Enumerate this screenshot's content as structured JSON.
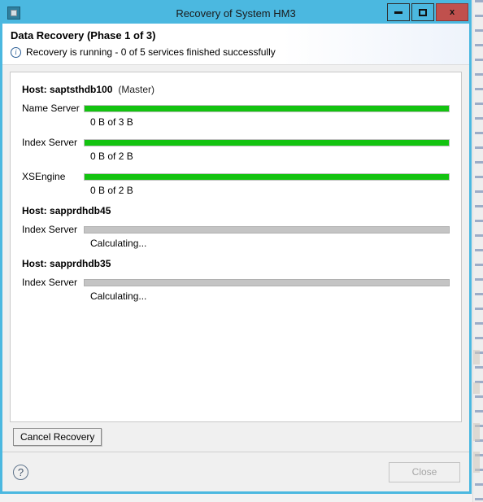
{
  "window": {
    "title": "Recovery of System HM3",
    "app_icon": "application-icon",
    "buttons": {
      "minimize": "minimize-icon",
      "maximize": "maximize-icon",
      "close": "x"
    }
  },
  "header": {
    "title": "Data Recovery (Phase 1 of 3)",
    "status_icon": "i",
    "status_text": "Recovery is running - 0 of 5 services finished successfully"
  },
  "colors": {
    "titlebar": "#4bb8e0",
    "close_button": "#c0504d",
    "progress_fill": "#13c310",
    "progress_indeterminate": "#c4c4c4"
  },
  "hosts": [
    {
      "label": "Host:",
      "name": "saptsthdb100",
      "role": "(Master)",
      "services": [
        {
          "name": "Name Server",
          "state": "determinate",
          "percent": 100,
          "sub": "0 B of 3 B"
        },
        {
          "name": "Index Server",
          "state": "determinate",
          "percent": 100,
          "sub": "0 B of 2 B"
        },
        {
          "name": "XSEngine",
          "state": "determinate",
          "percent": 100,
          "sub": "0 B of 2 B"
        }
      ]
    },
    {
      "label": "Host:",
      "name": "sapprdhdb45",
      "role": "",
      "services": [
        {
          "name": "Index Server",
          "state": "indeterminate",
          "percent": 0,
          "sub": "Calculating..."
        }
      ]
    },
    {
      "label": "Host:",
      "name": "sapprdhdb35",
      "role": "",
      "services": [
        {
          "name": "Index Server",
          "state": "indeterminate",
          "percent": 0,
          "sub": "Calculating..."
        }
      ]
    }
  ],
  "actions": {
    "cancel_recovery": "Cancel Recovery",
    "help": "?",
    "close": "Close"
  }
}
